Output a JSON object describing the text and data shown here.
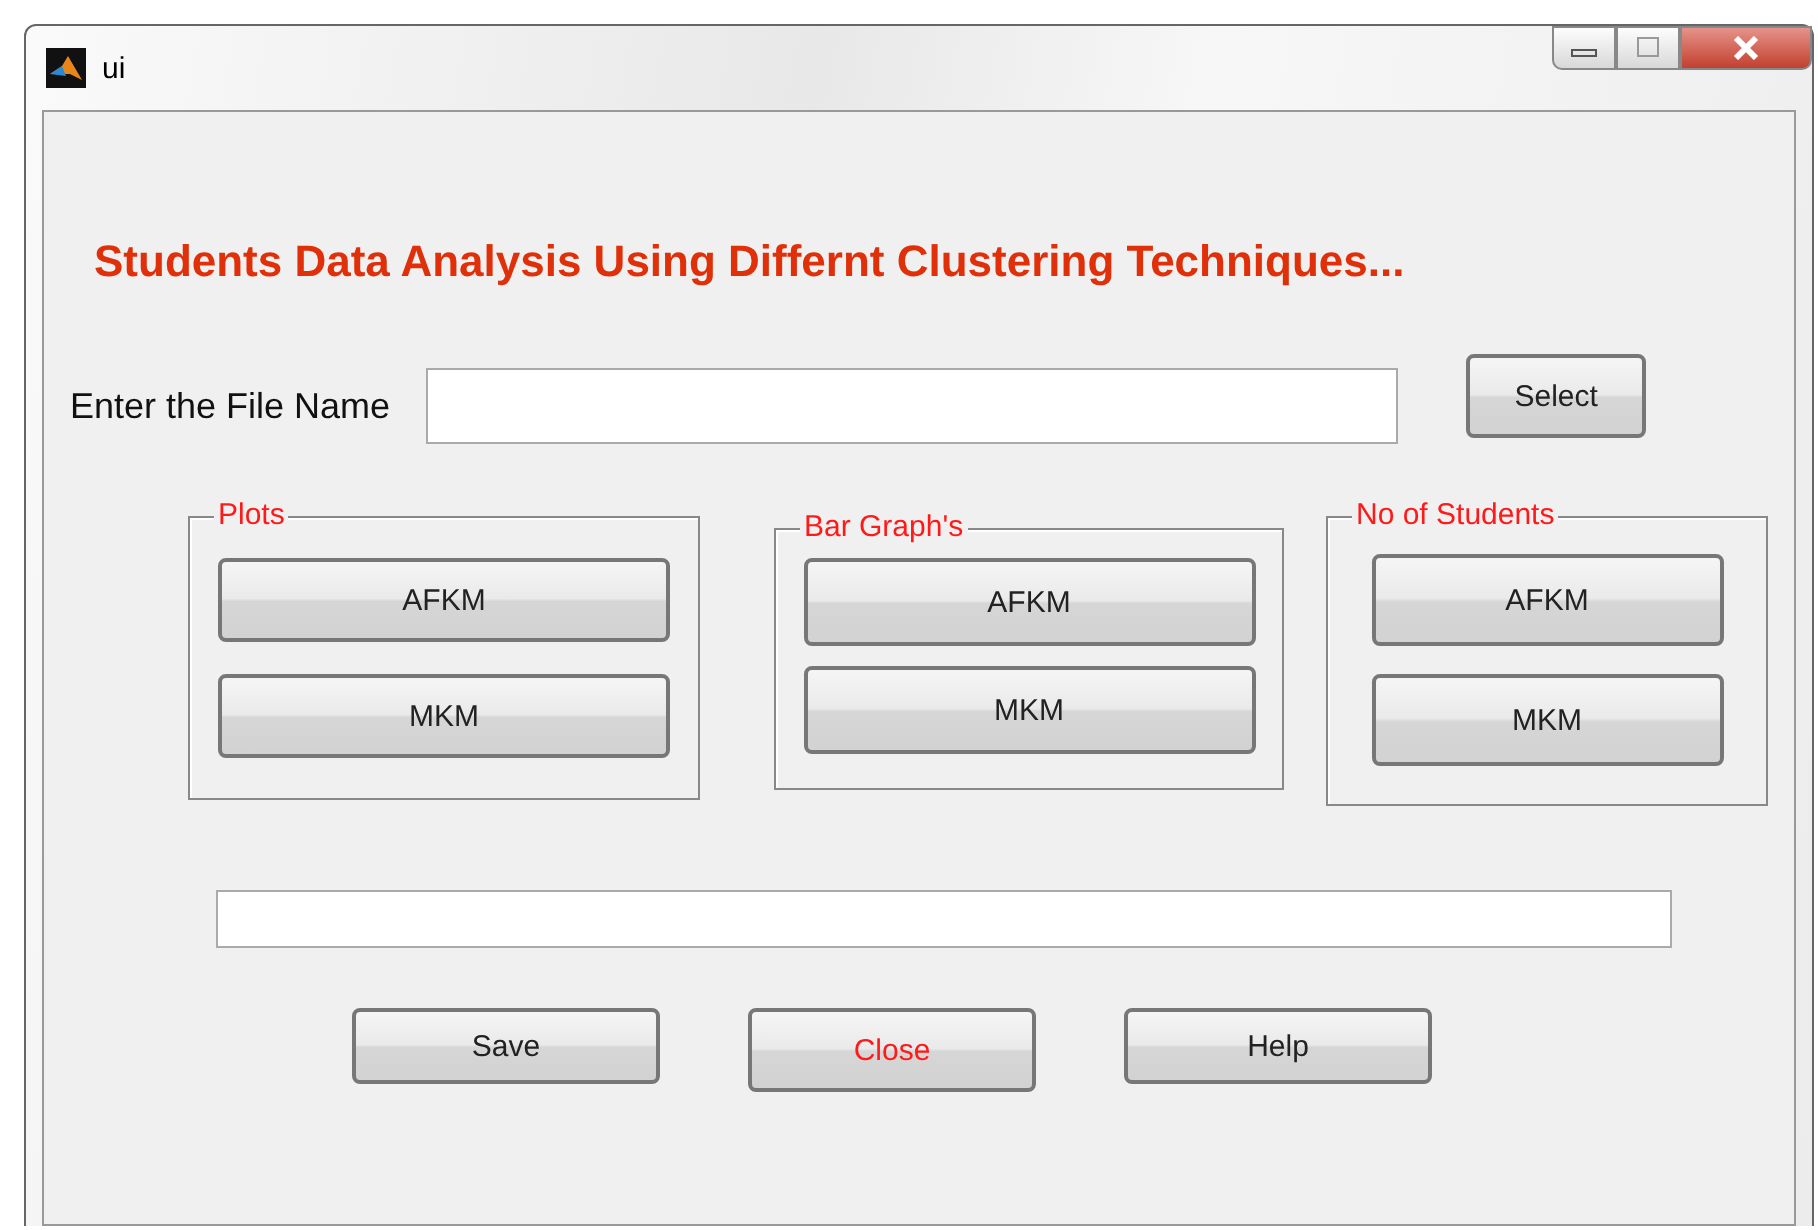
{
  "window": {
    "title": "ui"
  },
  "heading": "Students Data Analysis Using Differnt Clustering Techniques...",
  "file": {
    "label": "Enter the File Name",
    "button": "Select"
  },
  "panels": [
    {
      "title": "Plots",
      "buttons": [
        "AFKM",
        "MKM"
      ]
    },
    {
      "title": "Bar Graph's",
      "buttons": [
        "AFKM",
        "MKM"
      ]
    },
    {
      "title": "No of Students",
      "buttons": [
        "AFKM",
        "MKM"
      ]
    }
  ],
  "actions": [
    {
      "label": "Save",
      "kind": "normal"
    },
    {
      "label": "Close",
      "kind": "warning"
    },
    {
      "label": "Help",
      "kind": "normal"
    }
  ]
}
